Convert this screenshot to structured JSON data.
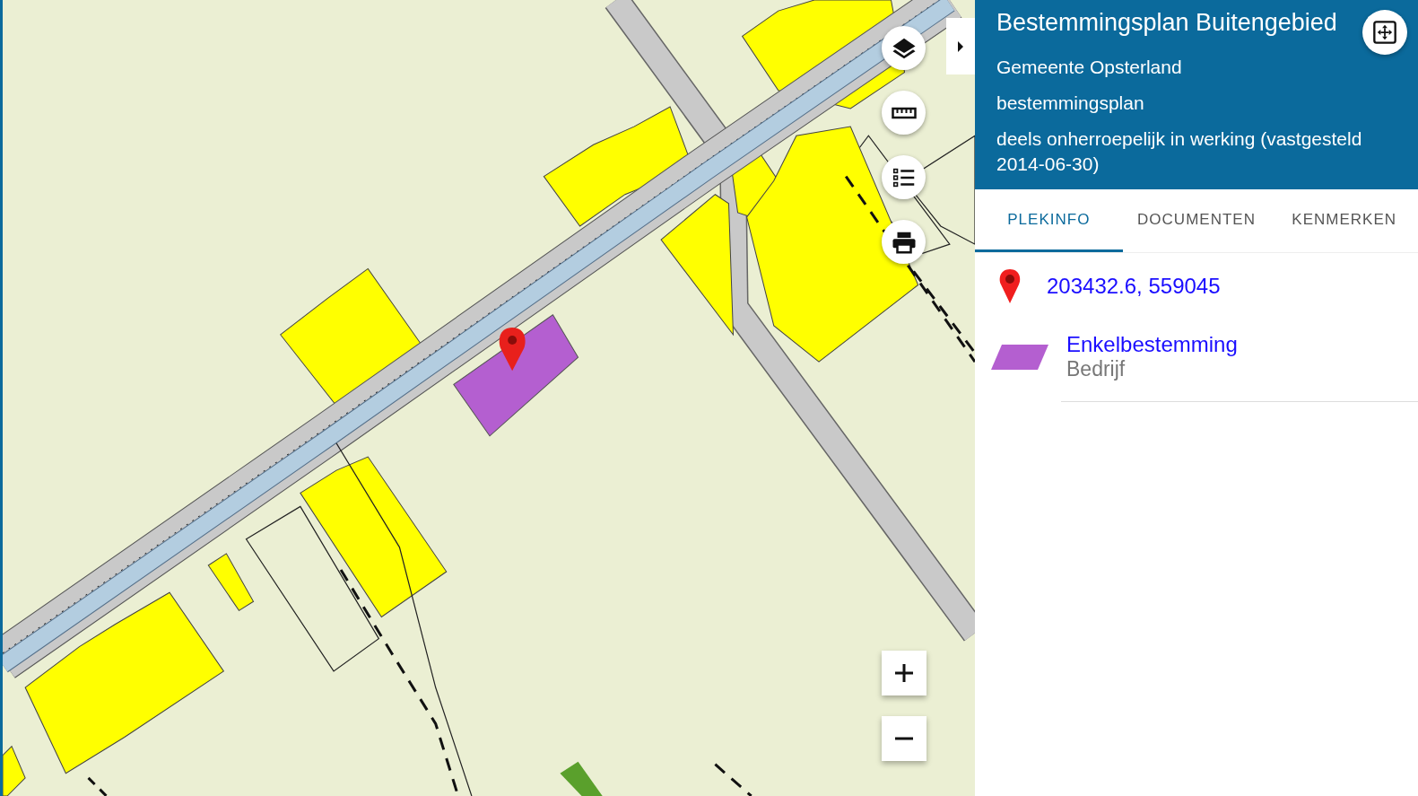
{
  "plan": {
    "title": "Bestemmingsplan Buitengebied",
    "lines": [
      "Gemeente Opsterland",
      "bestemmingsplan",
      "deels onherroepelijk in werking (vastgesteld 2014-06-30)"
    ]
  },
  "tabs": [
    {
      "label": "PLEKINFO",
      "selected": true
    },
    {
      "label": "DOCUMENTEN",
      "selected": false
    },
    {
      "label": "KENMERKEN",
      "selected": false
    }
  ],
  "location": {
    "coordinates": "203432.6, 559045"
  },
  "features": [
    {
      "title": "Enkelbestemming",
      "value": "Bedrijf",
      "color": "#b45fd0"
    }
  ]
}
